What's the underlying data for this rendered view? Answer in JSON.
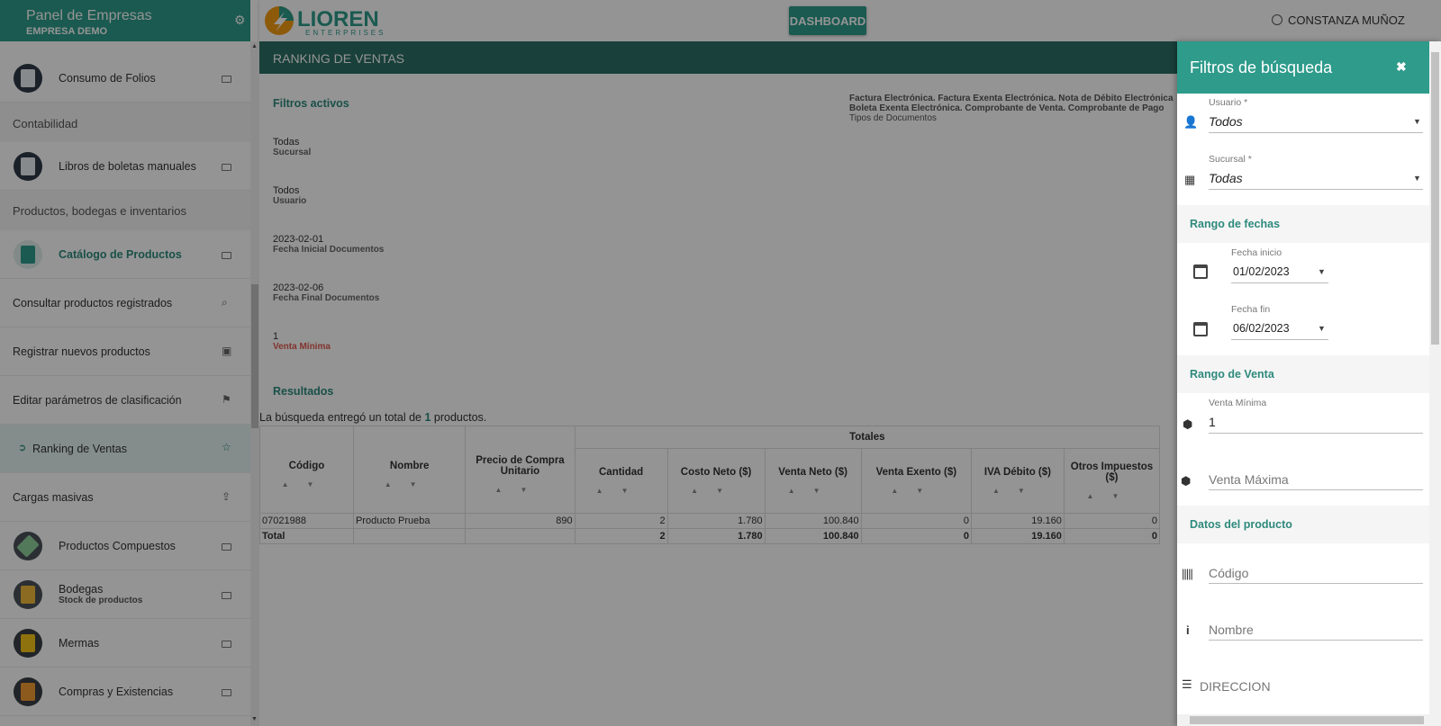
{
  "sidebar": {
    "title": "Panel de Empresas",
    "company": "EMPRESA DEMO",
    "items": [
      {
        "label": "Consumo de Folios"
      },
      {
        "section": "Contabilidad"
      },
      {
        "label": "Libros de boletas manuales"
      },
      {
        "section": "Productos, bodegas e inventarios"
      },
      {
        "label": "Catálogo de Productos"
      },
      {
        "label": "Consultar productos registrados"
      },
      {
        "label": "Registrar nuevos productos"
      },
      {
        "label": "Editar parámetros de clasificación"
      },
      {
        "label": "Ranking de Ventas"
      },
      {
        "label": "Cargas masivas"
      },
      {
        "label": "Productos Compuestos"
      },
      {
        "label": "Bodegas",
        "sub": "Stock de productos"
      },
      {
        "label": "Mermas"
      },
      {
        "label": "Compras y Existencias"
      }
    ]
  },
  "topbar": {
    "logo_main": "LIOREN",
    "logo_sub": "ENTERPRISES",
    "dashboard_label": "DASHBOARD",
    "user_name": "CONSTANZA MUÑOZ"
  },
  "main": {
    "header": "RANKING DE VENTAS",
    "active_filters_title": "Filtros activos",
    "doc_types_line1": "Factura Electrónica. Factura Exenta Electrónica. Nota de Débito Electrónica",
    "doc_types_line2": "Boleta Exenta Electrónica. Comprobante de Venta. Comprobante de Pago",
    "doc_types_label": "Tipos de Documentos",
    "filters": [
      {
        "value": "Todas",
        "label": "Sucursal"
      },
      {
        "value": "Todos",
        "label": "Usuario"
      },
      {
        "value": "2023-02-01",
        "label": "Fecha Inicial Documentos"
      },
      {
        "value": "2023-02-06",
        "label": "Fecha Final Documentos"
      },
      {
        "value": "1",
        "label": "Venta Mínima"
      }
    ],
    "results_title": "Resultados",
    "results_pre": "La búsqueda entregó un total de ",
    "results_count": "1",
    "results_post": " productos.",
    "table": {
      "group_header": "Totales",
      "headers": [
        "Código",
        "Nombre",
        "Precio de Compra Unitario",
        "Cantidad",
        "Costo Neto ($)",
        "Venta Neto ($)",
        "Venta Exento ($)",
        "IVA Débito ($)",
        "Otros Impuestos ($)"
      ],
      "rows": [
        [
          "07021988",
          "Producto Prueba",
          "890",
          "2",
          "1.780",
          "100.840",
          "0",
          "19.160",
          "0"
        ]
      ],
      "total_row": [
        "Total",
        "",
        "",
        "2",
        "1.780",
        "100.840",
        "0",
        "19.160",
        "0"
      ]
    }
  },
  "panel": {
    "title": "Filtros de búsqueda",
    "usuario_label": "Usuario *",
    "usuario_value": "Todos",
    "sucursal_label": "Sucursal *",
    "sucursal_value": "Todas",
    "fechas_section": "Rango de fechas",
    "fecha_inicio_label": "Fecha inicio",
    "fecha_inicio_value": "01/02/2023",
    "fecha_fin_label": "Fecha fin",
    "fecha_fin_value": "06/02/2023",
    "venta_section": "Rango de Venta",
    "venta_min_label": "Venta Mínima",
    "venta_min_value": "1",
    "venta_max_placeholder": "Venta Máxima",
    "producto_section": "Datos del producto",
    "codigo_placeholder": "Código",
    "nombre_placeholder": "Nombre",
    "direccion_placeholder": "DIRECCION"
  },
  "colors": {
    "accent": "#2e9b8b",
    "header_dark": "#2b6f64",
    "warning": "#e05a4f"
  }
}
